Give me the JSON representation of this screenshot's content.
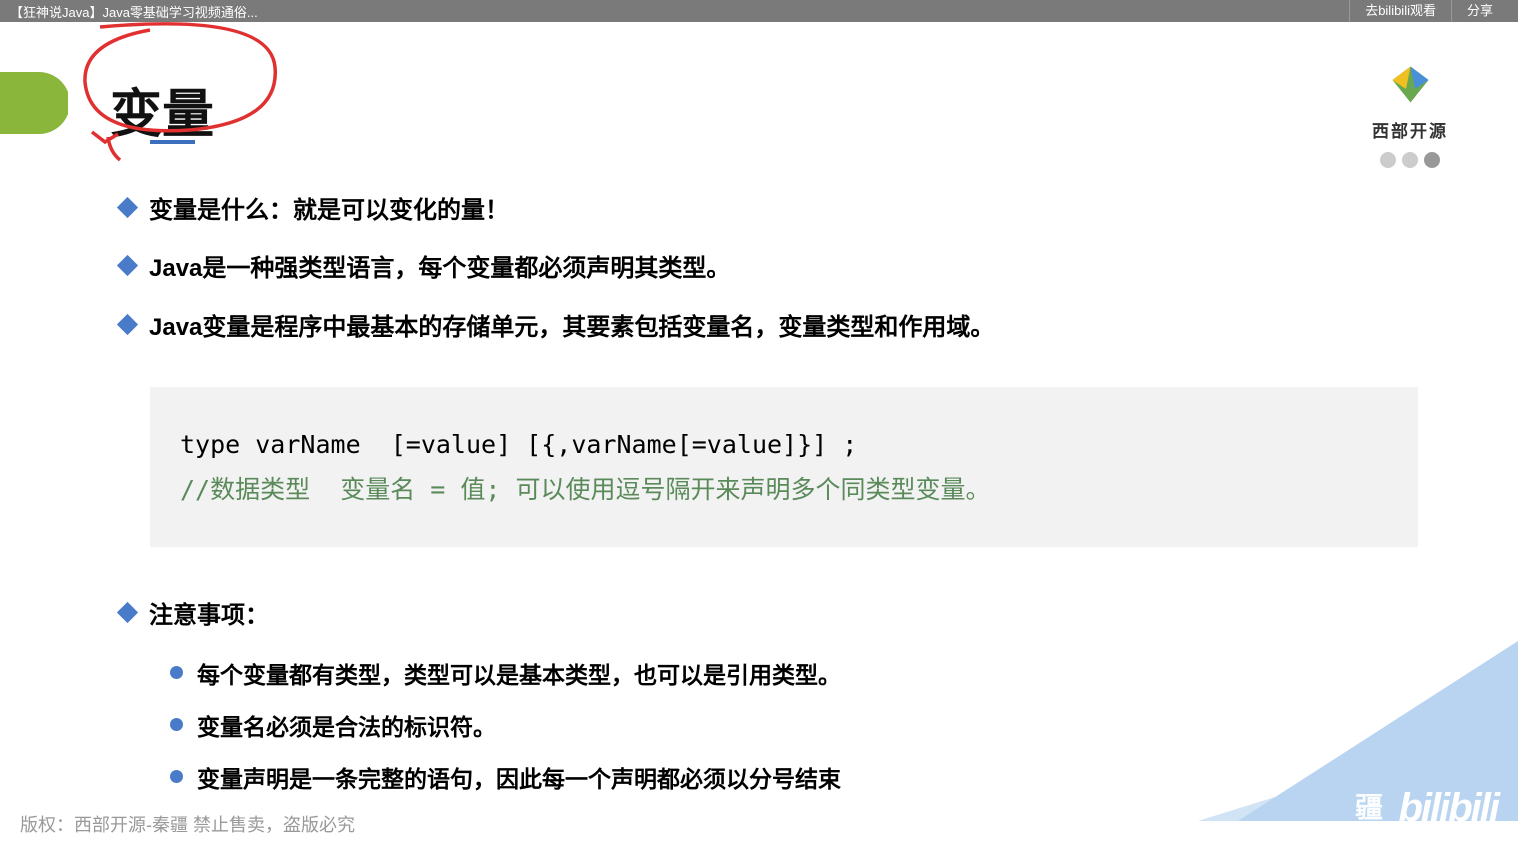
{
  "topbar": {
    "title": "【狂神说Java】Java零基础学习视频通俗...",
    "goto_btn": "去bilibili观看",
    "share_btn": "分享"
  },
  "slide": {
    "title": "变量",
    "bullets": [
      "变量是什么：就是可以变化的量！",
      "Java是一种强类型语言，每个变量都必须声明其类型。",
      "Java变量是程序中最基本的存储单元，其要素包括变量名，变量类型和作用域。"
    ],
    "code": {
      "line1": "type varName  [=value] [{,varName[=value]}] ;",
      "comment": "//数据类型  变量名 = 值; 可以使用逗号隔开来声明多个同类型变量。"
    },
    "section_title": "注意事项：",
    "sub_bullets": [
      "每个变量都有类型，类型可以是基本类型，也可以是引用类型。",
      "变量名必须是合法的标识符。",
      "变量声明是一条完整的语句，因此每一个声明都必须以分号结束"
    ],
    "logo_text": "西部开源"
  },
  "footer": {
    "copyright": "版权：西部开源-秦疆   禁止售卖，盗版必究"
  },
  "watermark": {
    "text": "疆",
    "logo": "bilibili"
  }
}
